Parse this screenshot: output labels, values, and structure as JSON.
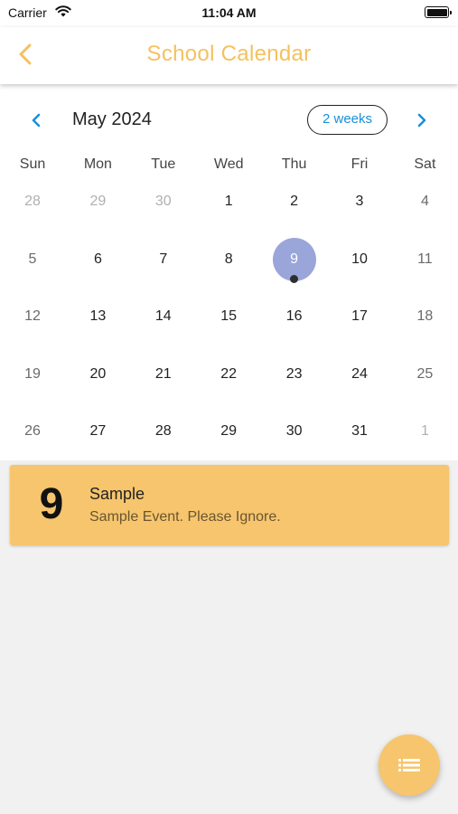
{
  "status_bar": {
    "carrier": "Carrier",
    "time": "11:04 AM"
  },
  "header": {
    "title": "School Calendar",
    "title_color": "#f4c15f"
  },
  "calendar": {
    "month_title": "May 2024",
    "format_button": "2 weeks",
    "weekdays": [
      "Sun",
      "Mon",
      "Tue",
      "Wed",
      "Thu",
      "Fri",
      "Sat"
    ],
    "weeks": [
      [
        {
          "d": "28",
          "outside": true
        },
        {
          "d": "29",
          "outside": true
        },
        {
          "d": "30",
          "outside": true
        },
        {
          "d": "1"
        },
        {
          "d": "2"
        },
        {
          "d": "3"
        },
        {
          "d": "4"
        }
      ],
      [
        {
          "d": "5"
        },
        {
          "d": "6"
        },
        {
          "d": "7"
        },
        {
          "d": "8"
        },
        {
          "d": "9",
          "selected": true,
          "event": true
        },
        {
          "d": "10"
        },
        {
          "d": "11"
        }
      ],
      [
        {
          "d": "12"
        },
        {
          "d": "13"
        },
        {
          "d": "14"
        },
        {
          "d": "15"
        },
        {
          "d": "16"
        },
        {
          "d": "17"
        },
        {
          "d": "18"
        }
      ],
      [
        {
          "d": "19"
        },
        {
          "d": "20"
        },
        {
          "d": "21"
        },
        {
          "d": "22"
        },
        {
          "d": "23"
        },
        {
          "d": "24"
        },
        {
          "d": "25"
        }
      ],
      [
        {
          "d": "26"
        },
        {
          "d": "27"
        },
        {
          "d": "28"
        },
        {
          "d": "29"
        },
        {
          "d": "30"
        },
        {
          "d": "31"
        },
        {
          "d": "1",
          "outside": true
        }
      ]
    ],
    "selected_color": "#9aa5da",
    "accent_color": "#1a8fd8"
  },
  "event": {
    "day": "9",
    "title": "Sample",
    "description": "Sample Event. Please Ignore.",
    "color": "#f6c56d"
  },
  "icons": {
    "back": "chevron-left-icon",
    "prev": "chevron-left-icon",
    "next": "chevron-right-icon",
    "fab": "list-icon"
  }
}
